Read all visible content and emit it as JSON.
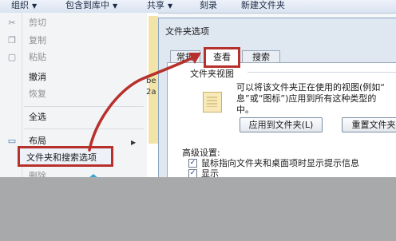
{
  "toolbar": {
    "organize": "组织",
    "include_library": "包含到库中",
    "share": "共享",
    "burn": "刻录",
    "new_folder": "新建文件夹"
  },
  "menu": {
    "items": [
      {
        "label": "剪切",
        "disabled": true,
        "icon": "scissors-icon"
      },
      {
        "label": "复制",
        "disabled": true,
        "icon": "copy-icon"
      },
      {
        "label": "粘贴",
        "disabled": true,
        "icon": "paste-icon"
      },
      {
        "label": "撤消",
        "disabled": false
      },
      {
        "label": "恢复",
        "disabled": true
      },
      {
        "label": "全选",
        "disabled": false
      },
      {
        "label": "布局",
        "disabled": false,
        "icon": "layout-icon"
      },
      {
        "label": "文件夹和搜索选项",
        "disabled": false,
        "highlighted": true
      },
      {
        "label": "删除",
        "disabled": true
      }
    ]
  },
  "middle": {
    "texts": [
      "be",
      "2a"
    ]
  },
  "dialog": {
    "title": "文件夹选项",
    "tabs": [
      {
        "label": "常规",
        "active": false
      },
      {
        "label": "查看",
        "active": true
      },
      {
        "label": "搜索",
        "active": false
      }
    ],
    "folder_views": {
      "label": "文件夹视图",
      "description_line1": "可以将该文件夹正在使用的视图(例如“",
      "description_line2": "息”或“图标”)应用到所有这种类型的",
      "description_line3": "中。",
      "apply_button": "应用到文件夹(L)",
      "reset_button": "重置文件夹"
    },
    "advanced": {
      "label": "高级设置:",
      "options": [
        {
          "text": "鼠标指向文件夹和桌面项时显示提示信息",
          "checked": true
        },
        {
          "text": "显示",
          "checked": true
        }
      ]
    }
  },
  "colors": {
    "annotation_red": "#b7312c",
    "accent_teal": "#3aa7d4"
  }
}
